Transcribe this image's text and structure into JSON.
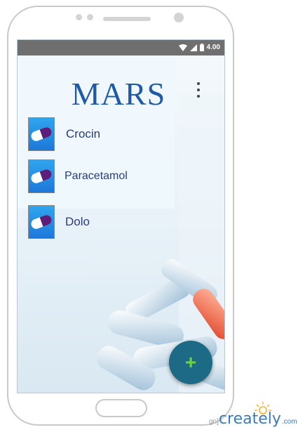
{
  "status_bar": {
    "time": "4.00"
  },
  "app": {
    "title": "MARS"
  },
  "medicines": [
    {
      "name": "Crocin"
    },
    {
      "name": "Paracetamol"
    },
    {
      "name": "Dolo"
    }
  ],
  "fab": {
    "label": "+"
  },
  "watermark": {
    "prefix": "gn]",
    "brand": "creately",
    "domain": ".com"
  },
  "colors": {
    "accent": "#1f5aa6",
    "fab": "#1c6a85",
    "fab_icon": "#6fd33a",
    "icon_bg": "#2fa6ee"
  }
}
